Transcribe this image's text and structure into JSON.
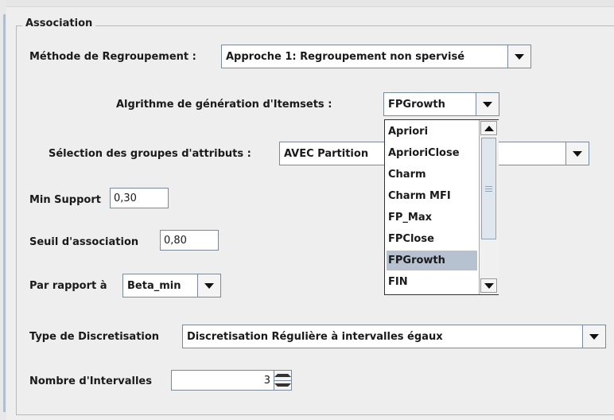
{
  "panel": {
    "title": "Association"
  },
  "methode": {
    "label": "Méthode de Regroupement :",
    "value": "Approche 1: Regroupement non spervisé"
  },
  "algo": {
    "label": "Algrithme de génération d'Itemsets :",
    "value": "FPGrowth"
  },
  "dropdown": {
    "options": [
      "Apriori",
      "AprioriClose",
      "Charm",
      "Charm MFI",
      "FP_Max",
      "FPClose",
      "FPGrowth",
      "FIN"
    ],
    "selected": "FPGrowth"
  },
  "selection": {
    "label": "Sélection des groupes d'attributs :",
    "value": "AVEC Partition"
  },
  "minsupport": {
    "label": "Min Support",
    "value": "0,30"
  },
  "seuil": {
    "label": "Seuil d'association",
    "value": "0,80"
  },
  "parrapport": {
    "label": "Par rapport à",
    "value": "Beta_min"
  },
  "discretisation": {
    "label": "Type de Discretisation",
    "value": "Discretisation Régulière à intervalles égaux"
  },
  "intervalles": {
    "label": "Nombre d'Intervalles",
    "value": "3"
  }
}
